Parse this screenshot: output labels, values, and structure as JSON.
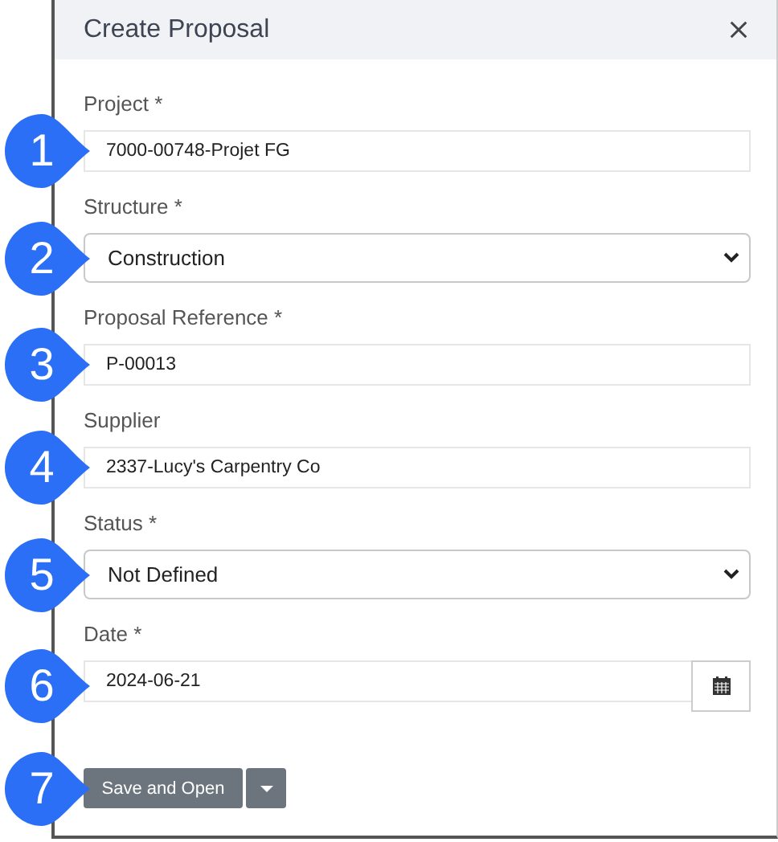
{
  "dialog": {
    "title": "Create Proposal"
  },
  "fields": [
    {
      "label": "Project *",
      "kind": "input",
      "value": "7000-00748-Projet FG",
      "callout": "1"
    },
    {
      "label": "Structure *",
      "kind": "select",
      "value": "Construction",
      "callout": "2"
    },
    {
      "label": "Proposal Reference *",
      "kind": "input",
      "value": "P-00013",
      "callout": "3"
    },
    {
      "label": "Supplier",
      "kind": "input",
      "value": "2337-Lucy's Carpentry Co",
      "callout": "4"
    },
    {
      "label": "Status *",
      "kind": "select",
      "value": "Not Defined",
      "callout": "5"
    },
    {
      "label": "Date *",
      "kind": "date",
      "value": "2024-06-21",
      "callout": "6"
    }
  ],
  "actions": {
    "primary": "Save and Open",
    "callout": "7"
  }
}
